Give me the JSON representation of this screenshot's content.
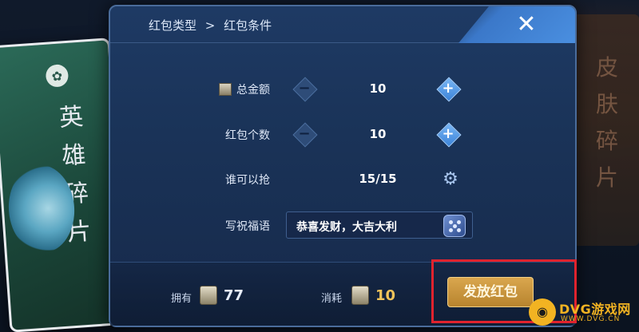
{
  "breadcrumb": {
    "parent": "红包类型",
    "separator": ">",
    "current": "红包条件"
  },
  "close": {
    "glyph": "✕"
  },
  "rows": {
    "total_amount": {
      "label": "总金额",
      "value": "10",
      "minus": "−",
      "plus": "+"
    },
    "count": {
      "label": "红包个数",
      "value": "10",
      "minus": "−",
      "plus": "+"
    },
    "who": {
      "label": "谁可以抢",
      "value": "15/15"
    },
    "blessing": {
      "label": "写祝福语",
      "value": "恭喜发财，大吉大利"
    }
  },
  "footer": {
    "own_label": "拥有",
    "own_value": "77",
    "cost_label": "消耗",
    "cost_value": "10",
    "send_label": "发放红包"
  },
  "background": {
    "left_card_text": "英雄碎片",
    "right_card_text": "皮肤碎片"
  },
  "watermark": {
    "brand": "DVG游戏网",
    "sub": "WWW.DVG.CN"
  },
  "colors": {
    "highlight": "#e0232e",
    "gold": "#f2c45a",
    "accent": "#3b83d9"
  }
}
